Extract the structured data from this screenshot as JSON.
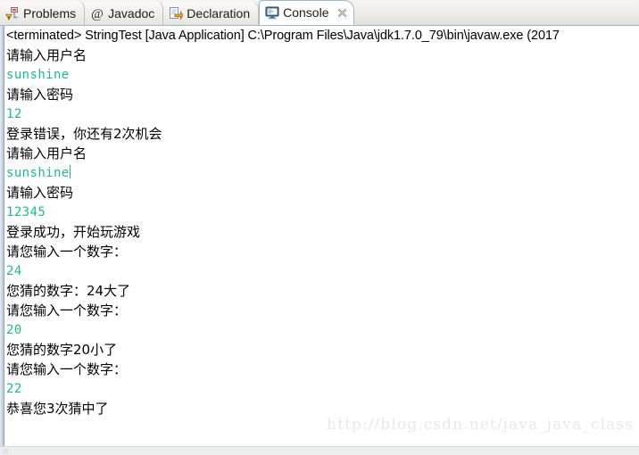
{
  "window": {
    "app": "Eclipse IDE",
    "view": "Console"
  },
  "tabbar": {
    "tabs": [
      {
        "label": "Problems",
        "icon": "problems-warning-icon",
        "active": false,
        "closable": false
      },
      {
        "label": "Javadoc",
        "icon": "javadoc-at-icon",
        "active": false,
        "closable": false
      },
      {
        "label": "Declaration",
        "icon": "declaration-icon",
        "active": false,
        "closable": false
      },
      {
        "label": "Console",
        "icon": "console-monitor-icon",
        "active": true,
        "closable": true
      }
    ],
    "close_glyph": "✕"
  },
  "console": {
    "header": "<terminated> StringTest [Java Application] C:\\Program Files\\Java\\jdk1.7.0_79\\bin\\javaw.exe (2017",
    "colors": {
      "output_text": "#000000",
      "input_text": "#1bbc8c",
      "background": "#ffffff",
      "tab_active_background": "#ffffff",
      "tab_border": "#9eb6cd",
      "watermark_text": "#e8e8e8"
    },
    "lines": [
      {
        "text": "请输入用户名",
        "kind": "output"
      },
      {
        "text": "sunshine",
        "kind": "input"
      },
      {
        "text": "请输入密码",
        "kind": "output"
      },
      {
        "text": "12",
        "kind": "input"
      },
      {
        "text": "登录错误，你还有2次机会",
        "kind": "output"
      },
      {
        "text": "请输入用户名",
        "kind": "output"
      },
      {
        "text": "sunshine",
        "kind": "input",
        "caret": true
      },
      {
        "text": "请输入密码",
        "kind": "output"
      },
      {
        "text": "12345",
        "kind": "input"
      },
      {
        "text": "登录成功，开始玩游戏",
        "kind": "output"
      },
      {
        "text": "请您输入一个数字：",
        "kind": "output"
      },
      {
        "text": "24",
        "kind": "input"
      },
      {
        "text": "您猜的数字：24大了",
        "kind": "output"
      },
      {
        "text": "请您输入一个数字：",
        "kind": "output"
      },
      {
        "text": "20",
        "kind": "input"
      },
      {
        "text": "您猜的数字20小了",
        "kind": "output"
      },
      {
        "text": "请您输入一个数字：",
        "kind": "output"
      },
      {
        "text": "22",
        "kind": "input"
      },
      {
        "text": "恭喜您3次猜中了",
        "kind": "output"
      }
    ]
  },
  "watermark": {
    "text": "http://blog.csdn.net/java_java_class"
  }
}
